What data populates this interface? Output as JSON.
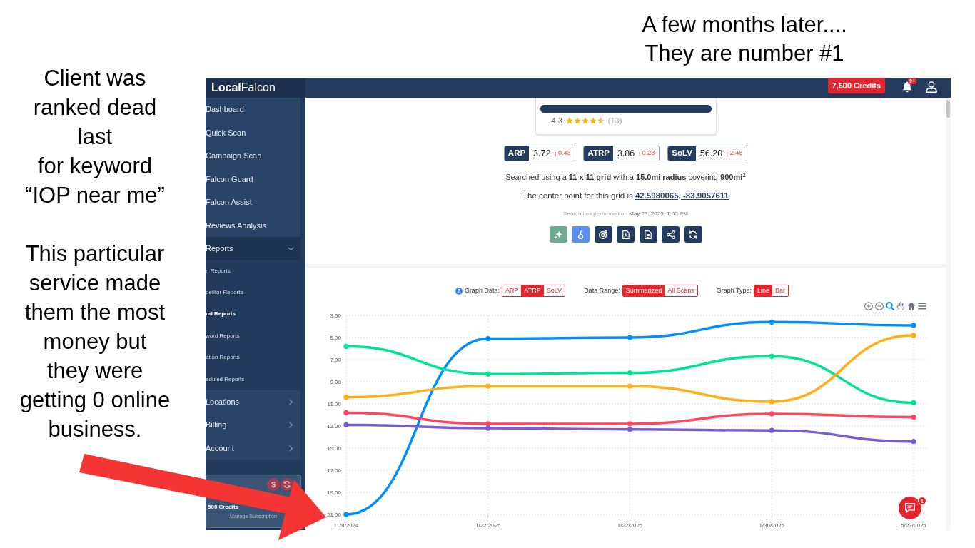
{
  "left_caption": [
    "Client was\nranked dead\nlast\nfor keyword\n“IOP near me”",
    "This particular\nservice made\nthem the most\nmoney but\nthey were\ngetting 0 online\nbusiness."
  ],
  "top_caption": "A few months later....\nThey are number #1",
  "inset": {
    "header": {
      "logo": "**Local**Falcon",
      "credits": "7,600 Credits",
      "notification_badge": "9+"
    },
    "sidebar": {
      "items": [
        {
          "kind": "link",
          "label": "Dashboard"
        },
        {
          "kind": "link",
          "label": "Quick Scan"
        },
        {
          "kind": "link",
          "label": "Campaign Scan"
        },
        {
          "kind": "link",
          "label": "Falcon Guard"
        },
        {
          "kind": "link",
          "label": "Falcon Assist"
        },
        {
          "kind": "link",
          "label": "Reviews Analysis"
        },
        {
          "kind": "group",
          "label": "Reports",
          "expanded": true,
          "children": [
            {
              "label": "n Reports",
              "selected": false
            },
            {
              "label": "petitor Reports",
              "selected": false
            },
            {
              "label": "nd Reports",
              "selected": true
            },
            {
              "label": "word Reports",
              "selected": false
            },
            {
              "label": "ation Reports",
              "selected": false
            },
            {
              "label": "eduled Reports",
              "selected": false
            }
          ]
        },
        {
          "kind": "group",
          "label": "Locations",
          "expanded": false
        },
        {
          "kind": "group",
          "label": "Billing",
          "expanded": false
        },
        {
          "kind": "group",
          "label": "Account",
          "expanded": false
        }
      ],
      "credits_card": {
        "currency_symbol": "$",
        "credits": "500 Credits",
        "link": "Manage Subscription"
      }
    },
    "business_card": {
      "rating": "4.3",
      "stars": 4.5,
      "review_count": "(13)"
    },
    "metrics": [
      {
        "label": "ARP",
        "value": "3.72",
        "arrow": "↑",
        "change": "0.43"
      },
      {
        "label": "ATRP",
        "value": "3.86",
        "arrow": "↑",
        "change": "0.28"
      },
      {
        "label": "SoLV",
        "value": "56.20",
        "arrow": "↓",
        "change": "2.48"
      }
    ],
    "search_summary": "Searched using a **11 x 11 grid** with a **15.0mi radius** covering **900mi**$^{2}$",
    "center_point": {
      "text": "The center point for this grid is",
      "link": "42.5980065, -83.9057611"
    },
    "last_performed": {
      "text": "Search last performed on",
      "date": "May 23, 2025, 1:55 PM"
    },
    "actions": [
      {
        "kind": "sparkle",
        "color": "#6fa98f"
      },
      {
        "kind": "hook",
        "color": "#5b8ef0"
      },
      {
        "kind": "target",
        "color": "#243b5d"
      },
      {
        "kind": "pdf",
        "color": "#243b5d"
      },
      {
        "kind": "document",
        "color": "#243b5d"
      },
      {
        "kind": "share",
        "color": "#243b5d"
      },
      {
        "kind": "refresh",
        "color": "#243b5d"
      }
    ],
    "chart": {
      "controls": [
        {
          "help": "?",
          "label": "Graph Data:",
          "options": [
            {
              "label": "ARP",
              "selected": false
            },
            {
              "label": "ATRP",
              "selected": true
            },
            {
              "label": "SoLV",
              "selected": false
            }
          ]
        },
        {
          "label": "Data Range:",
          "options": [
            {
              "label": "Summarized",
              "selected": true
            },
            {
              "label": "All Scans",
              "selected": false
            }
          ]
        },
        {
          "label": "Graph Type:",
          "options": [
            {
              "label": "Line",
              "selected": true
            },
            {
              "label": "Bar",
              "selected": false
            }
          ]
        }
      ],
      "toolbar": [
        {
          "kind": "zoom-in",
          "selected": false
        },
        {
          "kind": "zoom-out",
          "selected": false
        },
        {
          "kind": "zoom",
          "selected": true
        },
        {
          "kind": "pan",
          "selected": false
        },
        {
          "kind": "reset",
          "selected": false
        },
        {
          "kind": "menu",
          "selected": false
        }
      ],
      "chart_data": {
        "type": "line",
        "grid": true,
        "categories": [
          "11/8/2024",
          "1/22/2025",
          "1/22/2025",
          "1/30/2025",
          "5/23/2025"
        ],
        "series": [
          {
            "color": "#008ffb",
            "marker": "circle",
            "values": [
              21.0,
              5.1,
              5.0,
              3.6,
              3.9
            ]
          },
          {
            "color": "#00e396",
            "marker": "circle",
            "values": [
              5.8,
              8.3,
              8.2,
              6.7,
              10.9
            ]
          },
          {
            "color": "#feb019",
            "marker": "circle",
            "values": [
              10.4,
              9.4,
              9.4,
              10.8,
              4.8
            ]
          },
          {
            "color": "#ff4560",
            "marker": "circle",
            "values": [
              11.8,
              12.8,
              12.8,
              11.9,
              12.2
            ]
          },
          {
            "color": "#775dd0",
            "marker": "circle",
            "values": [
              12.9,
              13.2,
              13.3,
              13.4,
              14.4
            ]
          }
        ],
        "ylim": [
          21,
          3
        ],
        "yticks": [
          {
            "value": 3,
            "label": "3.00"
          },
          {
            "value": 5,
            "label": "5.00"
          },
          {
            "value": 7,
            "label": "7.00"
          },
          {
            "value": 9,
            "label": "9.00"
          },
          {
            "value": 11,
            "label": "11.00"
          },
          {
            "value": 13,
            "label": "13.00"
          },
          {
            "value": 15,
            "label": "15.00"
          },
          {
            "value": 17,
            "label": "17.00"
          },
          {
            "value": 19,
            "label": "19.00"
          },
          {
            "value": 21,
            "label": "21.00"
          }
        ]
      },
      "chat_badge": "1"
    }
  }
}
